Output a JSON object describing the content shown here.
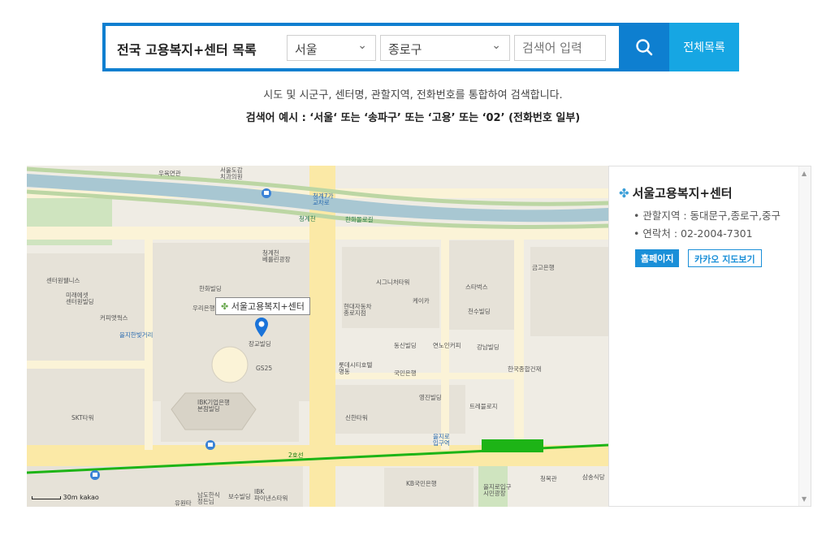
{
  "search": {
    "title": "전국 고용복지+센터 목록",
    "sido_selected": "서울",
    "gugun_selected": "종로구",
    "keyword_placeholder": "검색어 입력",
    "all_list_label": "전체목록"
  },
  "description": {
    "line1": "시도 및 시군구, 센터명, 관할지역, 전화번호를 통합하여 검색합니다.",
    "line2": "검색어 예시 : ‘서울‘ 또는 ‘송파구’ 또는 ‘고용’ 또는 ‘02’ (전화번호 일부)"
  },
  "map": {
    "infowindow_label": "서울고용복지+센터",
    "scale_label": "30m",
    "provider_label": "kakao",
    "place_labels": {
      "uyuk": "우육면관",
      "seoul_dogam": "서울도감\n치과의원",
      "cheonggye7": "청계7가\n교차로",
      "cheonggyecheon": "청계천",
      "hanwha": "한화몰로길",
      "cheonggye_mid": "청계천\n베를린광장",
      "hanwha_bldg": "한화빌딩",
      "woori": "우리은행",
      "sigma": "시그니처타워",
      "hyundai": "현대자동차\n종로지점",
      "keika": "케이카",
      "starbucks": "스타벅스",
      "cheonsu": "천수빌딩",
      "jangkyo": "장교빌딩",
      "gs25": "GS25",
      "center_welness": "센터원웰니스",
      "mirae": "미래에셋\n센터원빌딩",
      "coffee": "커피앳웍스",
      "euljiro_underground": "을지한빛거리",
      "skt": "SKT타워",
      "ibk": "IBK기업은행\n본점빌딩",
      "shinhan": "신한타워",
      "kb": "KB국민은행",
      "euljiro1": "을지로\n입구역",
      "lotte": "롯데시티호텔\n명동",
      "kookmin": "국민은행",
      "yongjin": "영진빌딩",
      "hanguk": "한국종합건재",
      "trait": "트레블로지",
      "euljiro_park": "을지로입구\n시민광장",
      "line2": "2호선",
      "chilgwang": "청목관",
      "samsong": "삼송식당",
      "ibk_bottom": "IBK\n파이낸스타워",
      "namdo": "남도한식\n정든님",
      "bosu": "보수빌딩",
      "jangkyo_bottom": "유원타",
      "dongin": "동신빌딩",
      "gangnam": "강남빌딩",
      "uno": "연노인커피",
      "keumgo": "금고은행"
    }
  },
  "center": {
    "name": "서울고용복지+센터",
    "jurisdiction_text": "관할지역 : 동대문구,종로구,중구",
    "contact_text": "연락처 : 02-2004-7301",
    "homepage_label": "홈페이지",
    "kakao_map_label": "카카오 지도보기"
  },
  "colors": {
    "primary": "#0e7fd0",
    "secondary": "#16a6e3",
    "stream": "#a8c7d2",
    "subway_line2": "#1db416",
    "road": "#fbe9a6",
    "map_bg": "#efece4"
  }
}
